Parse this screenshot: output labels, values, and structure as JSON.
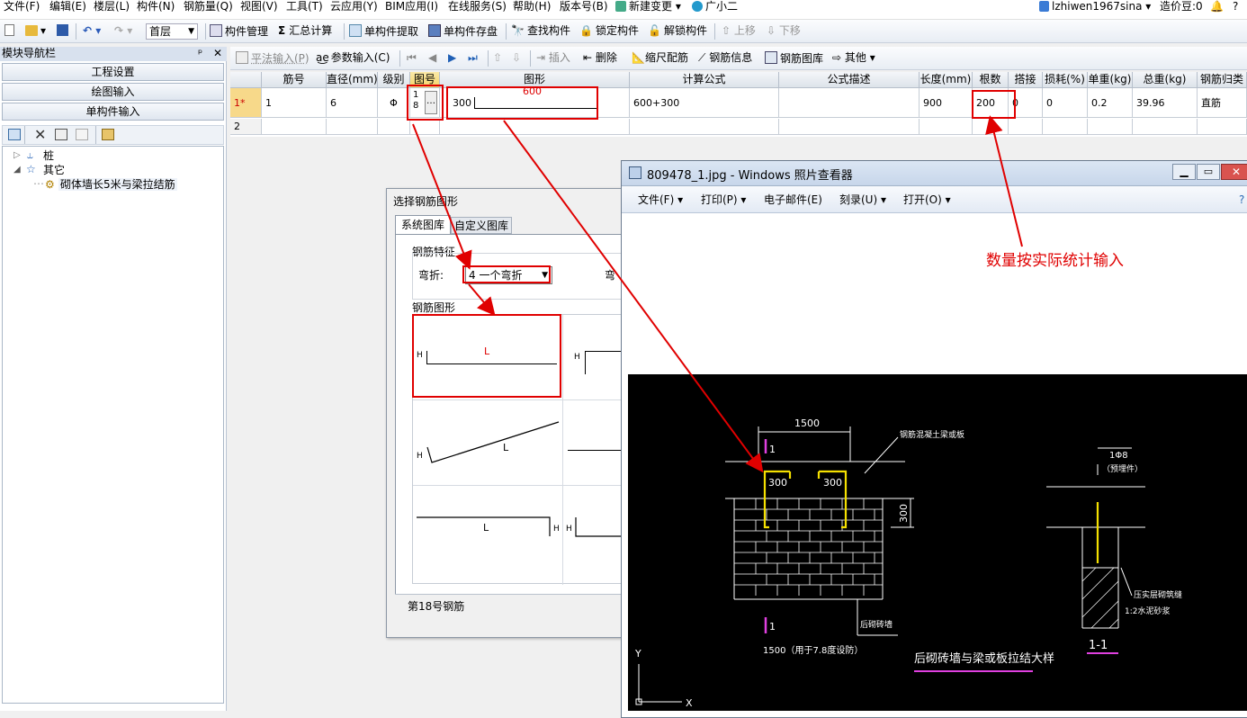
{
  "menu": [
    "文件(F)",
    "编辑(E)",
    "楼层(L)",
    "构件(N)",
    "钢筋量(Q)",
    "视图(V)",
    "工具(T)",
    "云应用(Y)",
    "BIM应用(I)",
    "在线服务(S)",
    "帮助(H)",
    "版本号(B)",
    "新建变更",
    "广小二"
  ],
  "user": {
    "name": "lzhiwen1967sina",
    "coins": "造价豆:0"
  },
  "toolbar1": {
    "floor": "首层",
    "items": [
      "构件管理",
      "汇总计算",
      "单构件提取",
      "单构件存盘",
      "查找构件",
      "锁定构件",
      "解锁构件",
      "上移",
      "下移"
    ]
  },
  "nav": {
    "title": "模块导航栏",
    "pin": "ᵖ",
    "close": "✕",
    "buttons": [
      "工程设置",
      "绘图输入",
      "单构件输入"
    ],
    "tree": {
      "n1": "桩",
      "n2": "其它",
      "n3": "砌体墙长5米与梁拉结筋"
    }
  },
  "toolbar2": {
    "items": [
      "平法输入(P)",
      "参数输入(C)",
      "插入",
      "删除",
      "缩尺配筋",
      "钢筋信息",
      "钢筋图库",
      "其他"
    ]
  },
  "grid": {
    "headers": [
      "筋号",
      "直径(mm)",
      "级别",
      "图号",
      "图形",
      "计算公式",
      "公式描述",
      "长度(mm)",
      "根数",
      "搭接",
      "损耗(%)",
      "单重(kg)",
      "总重(kg)",
      "钢筋归类"
    ],
    "row1": {
      "idx": "1*",
      "jinhao": "1",
      "diameter": "6",
      "grade": "Φ",
      "figno1": "1",
      "figno2": "8",
      "btn": "…",
      "shape_left": "300",
      "shape_mid": "600",
      "formula": "600+300",
      "desc": "",
      "length": "900",
      "count": "200",
      "lap": "0",
      "loss": "0",
      "unitw": "0.2",
      "totalw": "39.96",
      "category": "直筋"
    },
    "row2": {
      "idx": "2"
    }
  },
  "dialog": {
    "title": "选择钢筋图形",
    "tab1": "系统图库",
    "tab2": "自定义图库",
    "feature": "钢筋特征",
    "bend_label": "弯折:",
    "bend_value": "4 一个弯折",
    "bend_label2": "弯",
    "shape_group": "钢筋图形",
    "shape_L": "L",
    "shape_H": "H",
    "footer": "第18号钢筋"
  },
  "viewer": {
    "title": "809478_1.jpg - Windows 照片查看器",
    "menu": [
      "文件(F)",
      "打印(P)",
      "电子邮件(E)",
      "刻录(U)",
      "打开(O)"
    ]
  },
  "cad": {
    "dim1500": "1500",
    "dim300a": "300",
    "dim300b": "300",
    "dim300v": "300",
    "label_beam": "钢筋混凝土梁或板",
    "label_wall": "后砌砖墙",
    "label_bar": "1Φ8",
    "label_bar2": "（预埋件）",
    "label_plaster1": "压实层砌筑缝",
    "label_plaster2": "1:2水泥砂浆",
    "bottom_note": "1500（用于7.8度设防）",
    "title": "后砌砖墙与梁或板拉结大样",
    "section": "1-1",
    "mark1": "1",
    "mark2": "1",
    "axis_y": "Y",
    "axis_x": "X"
  },
  "annotation": "数量按实际统计输入"
}
